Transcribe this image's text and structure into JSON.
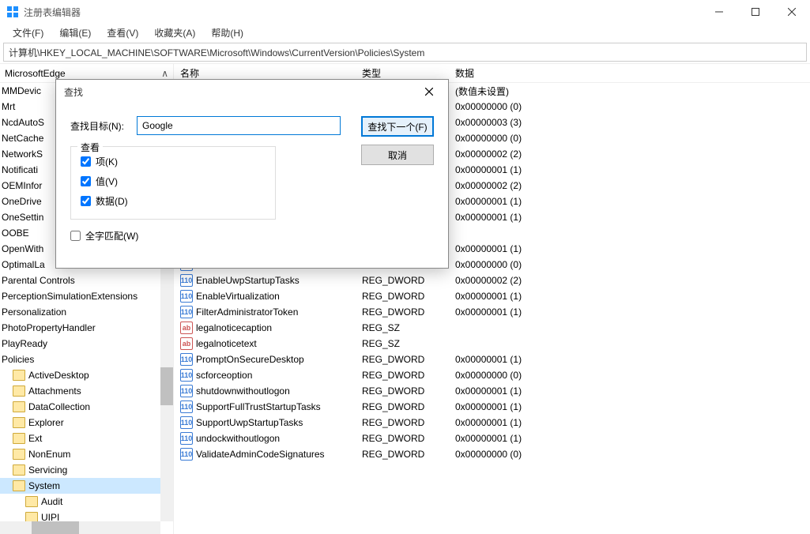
{
  "window": {
    "title": "注册表编辑器"
  },
  "menu": {
    "file": "文件(F)",
    "edit": "编辑(E)",
    "view": "查看(V)",
    "favorites": "收藏夹(A)",
    "help": "帮助(H)"
  },
  "address": "计算机\\HKEY_LOCAL_MACHINE\\SOFTWARE\\Microsoft\\Windows\\CurrentVersion\\Policies\\System",
  "treeHeader": {
    "label": "MicrosoftEdge",
    "chevron": "∧"
  },
  "tree": [
    {
      "label": "MMDevic",
      "indent": 0,
      "icon": false
    },
    {
      "label": "Mrt",
      "indent": 0,
      "icon": false
    },
    {
      "label": "NcdAutoS",
      "indent": 0,
      "icon": false
    },
    {
      "label": "NetCache",
      "indent": 0,
      "icon": false
    },
    {
      "label": "NetworkS",
      "indent": 0,
      "icon": false
    },
    {
      "label": "Notificati",
      "indent": 0,
      "icon": false
    },
    {
      "label": "OEMInfor",
      "indent": 0,
      "icon": false
    },
    {
      "label": "OneDrive",
      "indent": 0,
      "icon": false
    },
    {
      "label": "OneSettin",
      "indent": 0,
      "icon": false
    },
    {
      "label": "OOBE",
      "indent": 0,
      "icon": false
    },
    {
      "label": "OpenWith",
      "indent": 0,
      "icon": false
    },
    {
      "label": "OptimalLa",
      "indent": 0,
      "icon": false
    },
    {
      "label": "Parental Controls",
      "indent": 0,
      "icon": false
    },
    {
      "label": "PerceptionSimulationExtensions",
      "indent": 0,
      "icon": false
    },
    {
      "label": "Personalization",
      "indent": 0,
      "icon": false
    },
    {
      "label": "PhotoPropertyHandler",
      "indent": 0,
      "icon": false
    },
    {
      "label": "PlayReady",
      "indent": 0,
      "icon": false
    },
    {
      "label": "Policies",
      "indent": 0,
      "icon": false
    },
    {
      "label": "ActiveDesktop",
      "indent": 1,
      "icon": true
    },
    {
      "label": "Attachments",
      "indent": 1,
      "icon": true
    },
    {
      "label": "DataCollection",
      "indent": 1,
      "icon": true
    },
    {
      "label": "Explorer",
      "indent": 1,
      "icon": true
    },
    {
      "label": "Ext",
      "indent": 1,
      "icon": true
    },
    {
      "label": "NonEnum",
      "indent": 1,
      "icon": true
    },
    {
      "label": "Servicing",
      "indent": 1,
      "icon": true
    },
    {
      "label": "System",
      "indent": 1,
      "icon": true,
      "selected": true
    },
    {
      "label": "Audit",
      "indent": 2,
      "icon": true
    },
    {
      "label": "UIPI",
      "indent": 2,
      "icon": true
    }
  ],
  "listCols": {
    "name": "名称",
    "type": "类型",
    "data": "数据"
  },
  "list": [
    {
      "name": "",
      "type": "",
      "data": "(数值未设置)",
      "icon": "str"
    },
    {
      "name": "",
      "type": "",
      "data": "0x00000000 (0)",
      "icon": "bin"
    },
    {
      "name": "",
      "type": "",
      "data": "0x00000003 (3)",
      "icon": "bin"
    },
    {
      "name": "",
      "type": "",
      "data": "0x00000000 (0)",
      "icon": "bin"
    },
    {
      "name": "",
      "type": "",
      "data": "0x00000002 (2)",
      "icon": "bin"
    },
    {
      "name": "",
      "type": "",
      "data": "0x00000001 (1)",
      "icon": "bin"
    },
    {
      "name": "",
      "type": "",
      "data": "0x00000002 (2)",
      "icon": "bin"
    },
    {
      "name": "",
      "type": "",
      "data": "0x00000001 (1)",
      "icon": "bin"
    },
    {
      "name": "",
      "type": "",
      "data": "0x00000001 (1)",
      "icon": "bin"
    },
    {
      "name": "",
      "type": "",
      "data": "",
      "icon": "bin"
    },
    {
      "name": "",
      "type": "",
      "data": "0x00000001 (1)",
      "icon": "bin"
    },
    {
      "name": "",
      "type": "",
      "data": "0x00000000 (0)",
      "icon": "bin"
    },
    {
      "name": "EnableUwpStartupTasks",
      "type": "REG_DWORD",
      "data": "0x00000002 (2)",
      "icon": "bin",
      "cut": true
    },
    {
      "name": "EnableVirtualization",
      "type": "REG_DWORD",
      "data": "0x00000001 (1)",
      "icon": "bin"
    },
    {
      "name": "FilterAdministratorToken",
      "type": "REG_DWORD",
      "data": "0x00000001 (1)",
      "icon": "bin"
    },
    {
      "name": "legalnoticecaption",
      "type": "REG_SZ",
      "data": "",
      "icon": "str"
    },
    {
      "name": "legalnoticetext",
      "type": "REG_SZ",
      "data": "",
      "icon": "str"
    },
    {
      "name": "PromptOnSecureDesktop",
      "type": "REG_DWORD",
      "data": "0x00000001 (1)",
      "icon": "bin"
    },
    {
      "name": "scforceoption",
      "type": "REG_DWORD",
      "data": "0x00000000 (0)",
      "icon": "bin"
    },
    {
      "name": "shutdownwithoutlogon",
      "type": "REG_DWORD",
      "data": "0x00000001 (1)",
      "icon": "bin"
    },
    {
      "name": "SupportFullTrustStartupTasks",
      "type": "REG_DWORD",
      "data": "0x00000001 (1)",
      "icon": "bin"
    },
    {
      "name": "SupportUwpStartupTasks",
      "type": "REG_DWORD",
      "data": "0x00000001 (1)",
      "icon": "bin"
    },
    {
      "name": "undockwithoutlogon",
      "type": "REG_DWORD",
      "data": "0x00000001 (1)",
      "icon": "bin"
    },
    {
      "name": "ValidateAdminCodeSignatures",
      "type": "REG_DWORD",
      "data": "0x00000000 (0)",
      "icon": "bin"
    }
  ],
  "dialog": {
    "title": "查找",
    "targetLabel": "查找目标(N):",
    "targetValue": "Google",
    "findNext": "查找下一个(F)",
    "cancel": "取消",
    "lookAt": "查看",
    "keys": "项(K)",
    "values": "值(V)",
    "data": "数据(D)",
    "wholeWord": "全字匹配(W)"
  }
}
